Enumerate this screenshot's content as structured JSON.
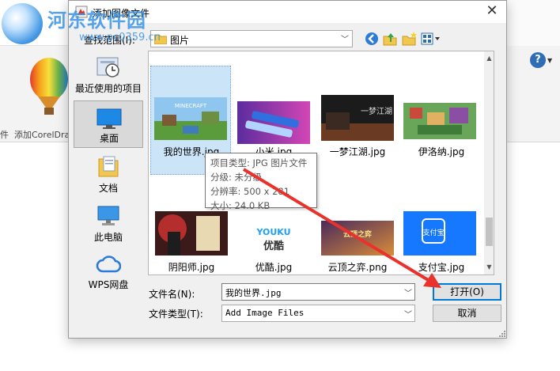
{
  "watermark": {
    "title": "河东软件园",
    "url": "www.pc0359.cn"
  },
  "background_app": {
    "ribbon_label": "添加CorelDra",
    "ribbon_label_prefix": "件",
    "help_label": "?"
  },
  "dialog": {
    "title": "添加图像文件",
    "close_label": "✕",
    "look_in_label": "查找范围(I):",
    "look_in_value": "图片",
    "places": [
      {
        "label": "最近使用的项目",
        "icon": "recent-items-icon"
      },
      {
        "label": "桌面",
        "icon": "desktop-icon"
      },
      {
        "label": "文档",
        "icon": "documents-icon"
      },
      {
        "label": "此电脑",
        "icon": "this-pc-icon"
      },
      {
        "label": "WPS网盘",
        "icon": "wps-cloud-icon"
      }
    ],
    "files": [
      {
        "name": "我的世界.jpg",
        "selected": true
      },
      {
        "name": "小米.jpg"
      },
      {
        "name": "一梦江湖.jpg"
      },
      {
        "name": "伊洛纳.jpg"
      },
      {
        "name": "阴阳师.jpg"
      },
      {
        "name": "优酷.jpg"
      },
      {
        "name": "云顶之弈.png"
      },
      {
        "name": "支付宝.jpg"
      }
    ],
    "thumb_text": {
      "minecraft": "MINECRAFT",
      "youku_brand": "YOUKU",
      "youku_cn": "优酷",
      "yimeng": "一梦江湖",
      "yunding": "云顶之弈",
      "alipay": "支付宝"
    },
    "tooltip": {
      "type": "项目类型: JPG 图片文件",
      "rating": "分级: 未分级",
      "resolution": "分辨率: 500 x 281",
      "size": "大小: 24.0 KB"
    },
    "file_name_label": "文件名(N):",
    "file_name_value": "我的世界.jpg",
    "file_type_label": "文件类型(T):",
    "file_type_value": "Add Image Files",
    "open_label": "打开(O)",
    "cancel_label": "取消"
  },
  "colors": {
    "accent": "#0078d7",
    "annotation_arrow": "#e8322b",
    "selection": "#cce4f7"
  }
}
